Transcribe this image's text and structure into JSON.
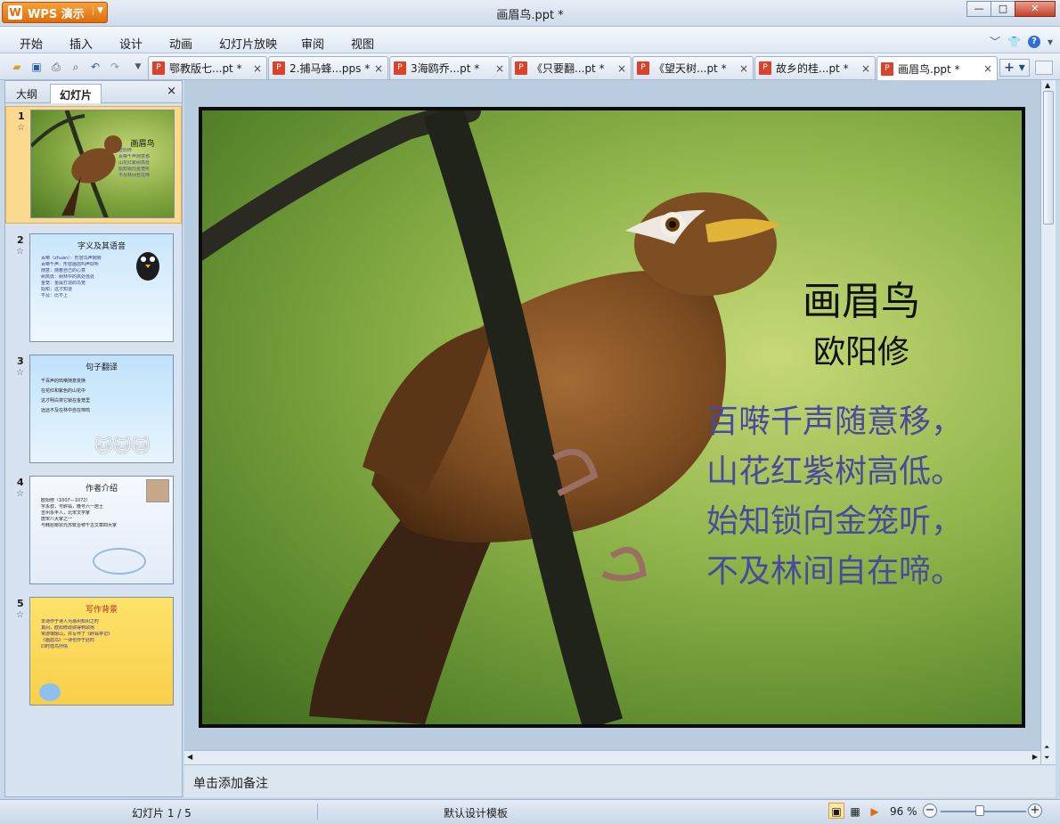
{
  "app": {
    "button_label": "WPS 演示",
    "logo_glyph": "W",
    "window_title": "画眉鸟.ppt *"
  },
  "window_controls": {
    "minimize": "—",
    "maximize": "□",
    "close": "✕"
  },
  "menu": [
    "开始",
    "插入",
    "设计",
    "动画",
    "幻灯片放映",
    "审阅",
    "视图"
  ],
  "tabs": [
    {
      "label": "鄂教版七...pt *",
      "active": false
    },
    {
      "label": "2.捕马蜂...pps *",
      "active": false
    },
    {
      "label": "3海鸥乔...pt *",
      "active": false
    },
    {
      "label": "《只要翻...pt *",
      "active": false
    },
    {
      "label": "《望天树...pt *",
      "active": false
    },
    {
      "label": "故乡的桂...pt *",
      "active": false
    },
    {
      "label": "画眉鸟.ppt *",
      "active": true
    }
  ],
  "tab_close_glyph": "×",
  "sidepanel": {
    "tabs": [
      "大纲",
      "幻灯片"
    ],
    "active_tab": "幻灯片",
    "close_glyph": "×",
    "thumbnails": [
      {
        "number": "1",
        "title": "画眉鸟",
        "lines": [
          "欧阳修",
          "百啭千声随意移",
          "山花红紫树高低",
          "始知锁向金笼听",
          "不及林间自在啼"
        ],
        "bg": "#7fa33e"
      },
      {
        "number": "2",
        "title": "字义及其语音",
        "lines": [
          "百啭（zhuàn）：形容鸟声婉转",
          "百啭千声：形容画眉叫声好听",
          "随意：随着自己的心意",
          "树高低：树林中的高处低处",
          "金笼：金属打造的鸟笼",
          "始知：这才知道",
          "不及：比不上"
        ],
        "bg": "#dbeeff"
      },
      {
        "number": "3",
        "title": "句子翻译",
        "lines": [
          "千百声的鸣啭随意变换",
          "在花红和紫色的山花中",
          "这才明白将它锁在金笼里",
          "远远不及在林中自在啼鸣"
        ],
        "bg": "#d6eeff"
      },
      {
        "number": "4",
        "title": "作者介绍",
        "lines": [
          "欧阳修（1007—1072）",
          "字永叔，号醉翁，晚号六一居士",
          "吉州永丰人，北宋文学家",
          "唐宋八大家之一",
          "与韩愈柳宗元苏轼合称千古文章四大家"
        ],
        "bg": "#f4f8ff"
      },
      {
        "number": "5",
        "title": "写作背景",
        "lines": [
          "本诗作于诗人为滁州知州之时",
          "其间，欧阳修政绩得到颂扬",
          "常游琅琊山，并写作了《醉翁亭记》",
          "《画眉鸟》一诗也作于此时",
          "同时借鸟抒情"
        ],
        "bg": "#fde36a"
      }
    ]
  },
  "slide": {
    "title": "画眉鸟",
    "author": "欧阳修",
    "poem": [
      "百啭千声随意移，",
      "山花红紫树高低。",
      "始知锁向金笼听，",
      "不及林间自在啼。"
    ]
  },
  "notes_placeholder": "单击添加备注",
  "status": {
    "slides": "幻灯片 1 / 5",
    "template": "默认设计模板",
    "zoom": "96 %"
  },
  "colors": {
    "accent": "#e06c0c",
    "poem_text": "#4a4a9d",
    "selected_thumb": "#fbd98f"
  }
}
